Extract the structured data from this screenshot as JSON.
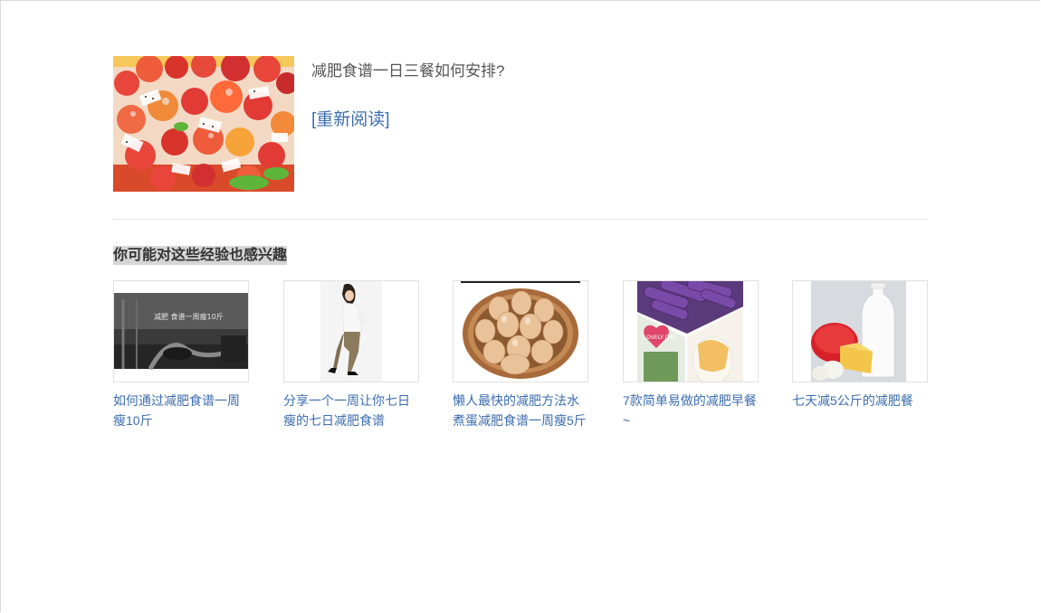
{
  "article": {
    "title": "减肥食谱一日三餐如何安排?",
    "reread_label": "[重新阅读]",
    "image_icon": "fruit-salad-image"
  },
  "recommendations": {
    "heading": "你可能对这些经验也感兴趣",
    "items": [
      {
        "label": "如何通过减肥食谱一周瘦10斤",
        "thumb_caption": "减肥 食谱一周瘦10斤",
        "image_icon": "treadmill-image"
      },
      {
        "label": "分享一个一周让你七日瘦的七日减肥食谱",
        "image_icon": "slim-woman-image"
      },
      {
        "label": "懒人最快的减肥方法水煮蛋减肥食谱一周瘦5斤",
        "image_icon": "egg-basket-image"
      },
      {
        "label": "7款简单易做的减肥早餐~",
        "thumb_caption": "LOVELY DAY",
        "image_icon": "purple-yam-image"
      },
      {
        "label": "七天减5公斤的减肥餐",
        "image_icon": "milk-cheese-image"
      }
    ]
  },
  "colors": {
    "link": "#3c6db0",
    "title_text": "#555555",
    "heading_text": "#333333",
    "heading_highlight": "#d6d6d6",
    "divider": "#e3e3e3"
  }
}
